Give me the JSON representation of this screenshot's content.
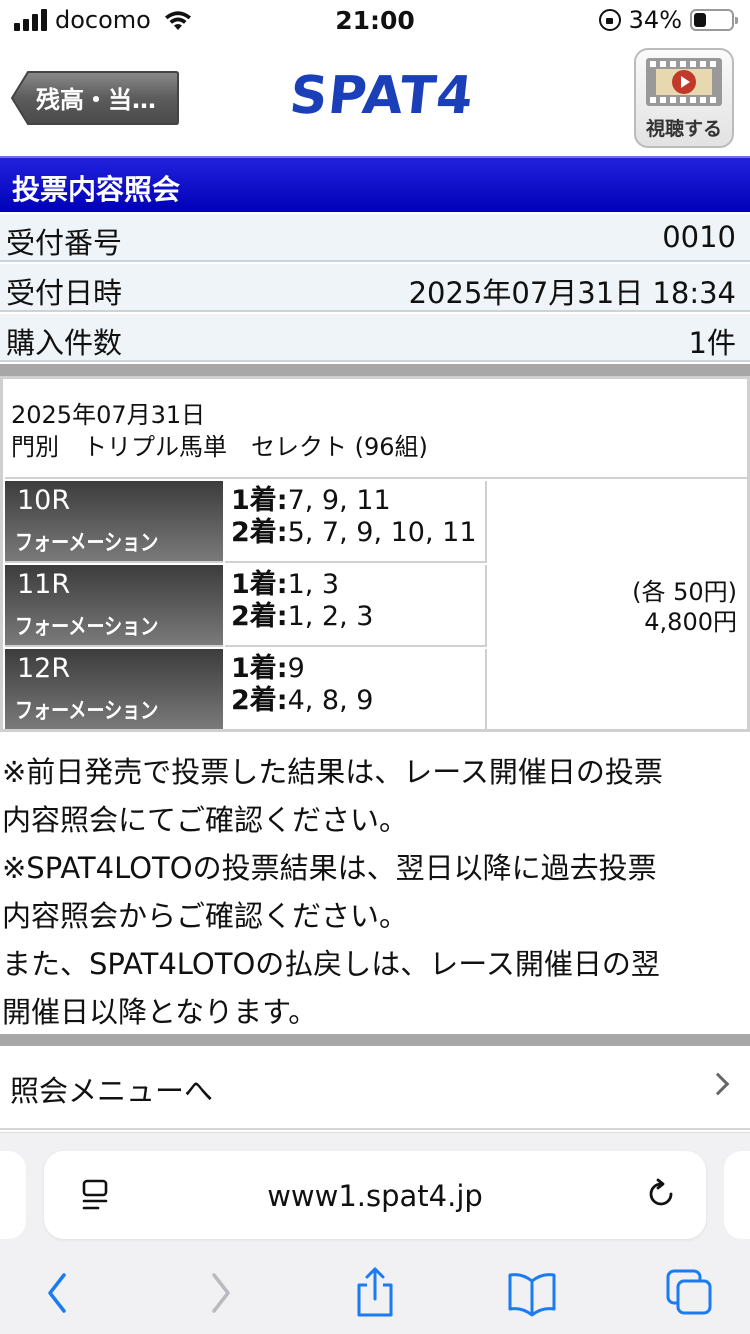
{
  "status_bar": {
    "carrier": "docomo",
    "time": "21:00",
    "battery_text": "34%",
    "battery_level": 0.34
  },
  "header": {
    "back_label": "残高・当…",
    "logo": "SPAT4",
    "watch_label": "視聴する"
  },
  "section_title": "投票内容照会",
  "info_rows": [
    {
      "label": "受付番号",
      "value": "0010"
    },
    {
      "label": "受付日時",
      "value": "2025年07月31日 18:34"
    },
    {
      "label": "購入件数",
      "value": "1件"
    }
  ],
  "bet": {
    "date": "2025年07月31日",
    "summary": "門別　トリプル馬単　セレクト (96組)",
    "races": [
      {
        "race": "10R",
        "type": "フォーメーション",
        "first_label": "1着:",
        "first": "7, 9, 11",
        "second_label": "2着:",
        "second": "5, 7, 9, 10, 11"
      },
      {
        "race": "11R",
        "type": "フォーメーション",
        "first_label": "1着:",
        "first": "1, 3",
        "second_label": "2着:",
        "second": "1, 2, 3"
      },
      {
        "race": "12R",
        "type": "フォーメーション",
        "first_label": "1着:",
        "first": "9",
        "second_label": "2着:",
        "second": "4, 8, 9"
      }
    ],
    "unit_price": "(各 50円)",
    "total": "4,800円"
  },
  "notes": [
    "※前日発売で投票した結果は、レース開催日の投票",
    "内容照会にてご確認ください。",
    "※SPAT4LOTOの投票結果は、翌日以降に過去投票",
    "内容照会からご確認ください。",
    "また、SPAT4LOTOの払戻しは、レース開催日の翌",
    "開催日以降となります。"
  ],
  "menu_link": "照会メニューへ",
  "browser": {
    "url": "www1.spat4.jp"
  },
  "colors": {
    "brand_blue": "#1a3fb8",
    "title_bar": "#0000b8",
    "ios_blue": "#1a7cf0"
  }
}
